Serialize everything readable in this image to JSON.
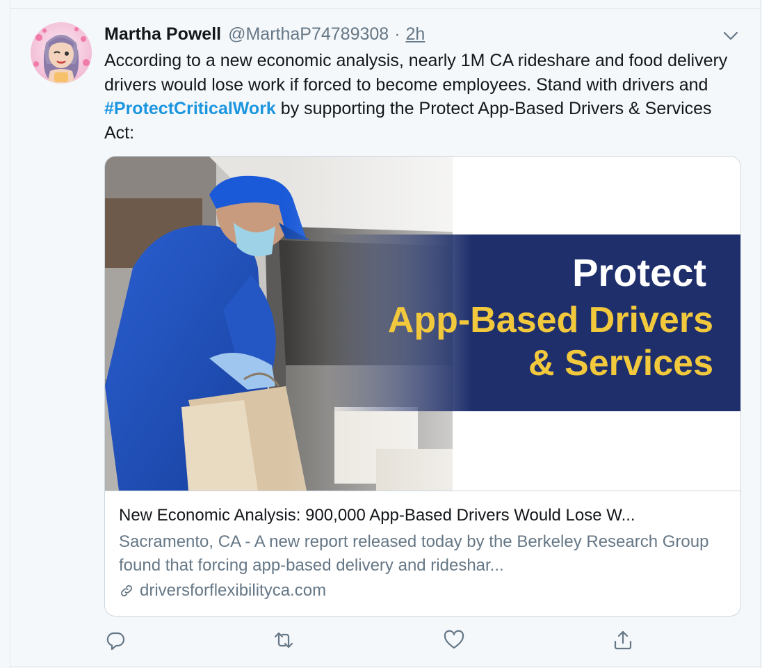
{
  "tweet": {
    "name": "Martha Powell",
    "handle": "@MarthaP74789308",
    "separator": "·",
    "time": "2h",
    "text_parts": {
      "before_hashtag": "According to a new economic analysis, nearly 1M CA rideshare and food delivery drivers would lose work if forced to become employees. Stand with drivers and ",
      "hashtag": "#ProtectCriticalWork",
      "after_hashtag": " by supporting the Protect App-Based Drivers & Services Act:"
    },
    "colors": {
      "hashtag": "#1b95e0",
      "secondary_text": "#657786",
      "banner_navy": "#1e2f6b",
      "banner_yellow": "#f2c83c"
    }
  },
  "card": {
    "image": {
      "banner_line1": "Protect",
      "banner_line2": "App-Based Drivers",
      "banner_line3": "& Services"
    },
    "title": "New Economic Analysis: 900,000 App-Based Drivers Would Lose W...",
    "description": "Sacramento, CA - A new report released today by the Berkeley Research Group found that forcing app-based delivery and rideshar...",
    "domain": "driversforflexibilityca.com"
  },
  "icons": {
    "menu": "chevron-down-icon",
    "reply": "reply-icon",
    "retweet": "retweet-icon",
    "like": "like-icon",
    "share": "share-icon",
    "link": "link-icon"
  }
}
